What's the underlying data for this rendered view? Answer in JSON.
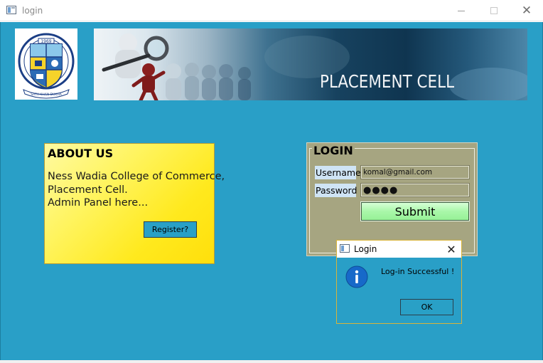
{
  "window": {
    "title": "login",
    "icon": "app-window-icon",
    "controls": {
      "minimize": "minimize-icon",
      "maximize": "maximize-icon",
      "close": "close-icon"
    }
  },
  "colors": {
    "background": "#299fc7",
    "about_panel": "#fff45f",
    "login_panel": "#a6a581",
    "submit_button": "#a9f7a9",
    "dialog_border": "#d9b43a"
  },
  "logo": {
    "emblem": "college-crest-emblem",
    "year": "1969",
    "motto": "SATH KHAN DUKHA"
  },
  "banner": {
    "text": "PLACEMENT CELL",
    "image": "magnifier-and-people-illustration"
  },
  "about": {
    "title": "ABOUT US",
    "lines": [
      "Ness Wadia College of Commerce,",
      "Placement Cell.",
      "Admin Panel here..."
    ],
    "register_label": "Register?"
  },
  "login": {
    "title": "LOGIN",
    "username_label": "Username",
    "username_value": "komal@gmail.com",
    "password_label": "Password",
    "password_value": "●●●●",
    "submit_label": "Submit"
  },
  "dialog": {
    "title": "Login",
    "message": "Log-in Successful !",
    "icon": "info-icon",
    "ok_label": "OK",
    "close_glyph": "✕"
  }
}
